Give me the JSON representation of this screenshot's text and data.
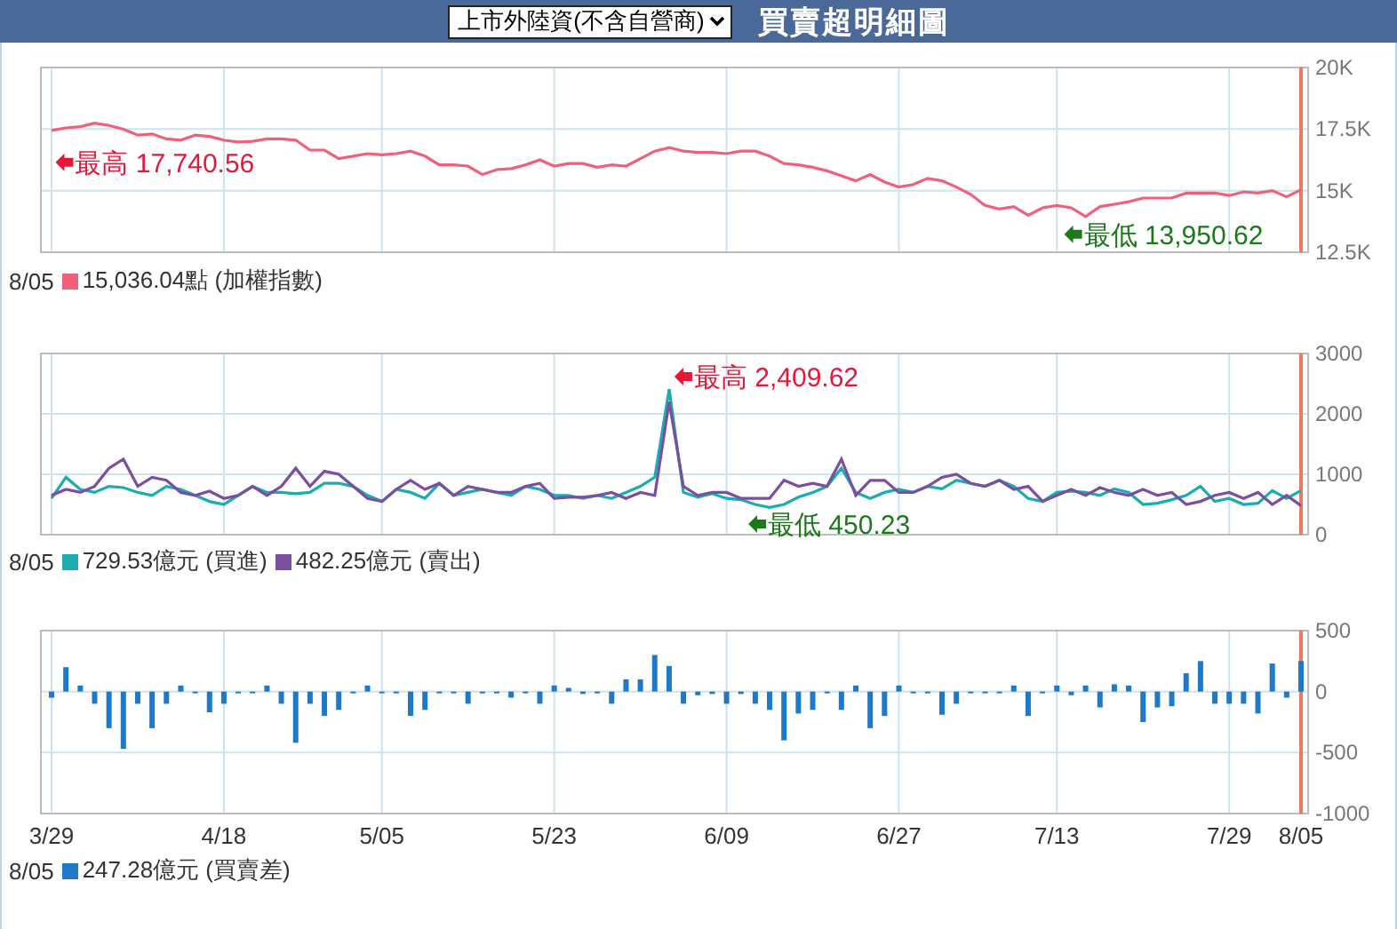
{
  "header": {
    "select": {
      "value": "上市外陸資(不含自營商)"
    },
    "title": "買賣超明細圖"
  },
  "charts": [
    {
      "legend": {
        "date": "8/05",
        "items": [
          {
            "color": "#f0607a",
            "text": "15,036.04點 (加權指數)"
          }
        ]
      },
      "extremes": [
        {
          "kind": "high",
          "text": "最高 17,740.56",
          "color": "#e8173a"
        },
        {
          "kind": "low",
          "text": "最低 13,950.62",
          "color": "#1a7a1a"
        }
      ],
      "chart_data": {
        "type": "line",
        "grid": true,
        "categories": [
          null,
          null,
          null,
          null,
          null,
          null,
          null,
          null,
          null,
          null,
          null,
          null,
          null,
          null,
          null,
          null,
          null,
          null,
          null,
          null,
          null,
          null,
          null,
          null,
          null,
          null,
          null,
          null,
          null,
          null,
          null,
          null,
          null,
          null,
          null,
          null,
          null,
          null,
          null,
          null,
          null,
          null,
          null,
          null,
          null,
          null,
          null,
          null,
          null,
          null,
          null,
          null,
          null,
          null,
          null,
          null,
          null,
          null,
          null,
          null,
          null,
          null,
          null,
          null,
          null,
          null,
          null,
          null,
          null,
          null,
          null,
          null,
          null,
          null,
          null,
          null,
          null,
          null,
          null,
          null,
          null,
          null,
          null,
          null,
          null,
          null,
          null,
          null
        ],
        "ylim": [
          12500,
          20000
        ],
        "yticks": [
          {
            "value": 12500,
            "label": "12.5K"
          },
          {
            "value": 15000,
            "label": "15K"
          },
          {
            "value": 17500,
            "label": "17.5K"
          },
          {
            "value": 20000,
            "label": "20K"
          }
        ],
        "series": [
          {
            "color": "#f0607a",
            "values": [
              17450,
              17550,
              17600,
              17740,
              17650,
              17500,
              17250,
              17300,
              17100,
              17050,
              17250,
              17200,
              17050,
              16980,
              17000,
              17100,
              17100,
              17050,
              16650,
              16650,
              16300,
              16400,
              16500,
              16450,
              16500,
              16600,
              16400,
              16050,
              16050,
              16000,
              15650,
              15850,
              15900,
              16050,
              16250,
              16000,
              16100,
              16100,
              15950,
              16050,
              16000,
              16300,
              16600,
              16750,
              16600,
              16550,
              16550,
              16500,
              16600,
              16600,
              16400,
              16100,
              16050,
              15950,
              15800,
              15600,
              15400,
              15650,
              15350,
              15150,
              15250,
              15500,
              15400,
              15150,
              14850,
              14400,
              14250,
              14350,
              14000,
              14300,
              14400,
              14300,
              13950,
              14350,
              14450,
              14550,
              14700,
              14700,
              14700,
              14900,
              14900,
              14900,
              14800,
              14950,
              14900,
              15000,
              14750,
              15040
            ]
          }
        ]
      }
    },
    {
      "legend": {
        "date": "8/05",
        "items": [
          {
            "color": "#1aacb0",
            "text": "729.53億元 (買進)"
          },
          {
            "color": "#7b4fa0",
            "text": "482.25億元 (賣出)"
          }
        ]
      },
      "extremes": [
        {
          "kind": "high",
          "text": "最高 2,409.62",
          "color": "#e8173a"
        },
        {
          "kind": "low",
          "text": "最低 450.23",
          "color": "#1a7a1a"
        }
      ],
      "chart_data": {
        "type": "line",
        "grid": true,
        "categories": [
          null,
          null,
          null,
          null,
          null,
          null,
          null,
          null,
          null,
          null,
          null,
          null,
          null,
          null,
          null,
          null,
          null,
          null,
          null,
          null,
          null,
          null,
          null,
          null,
          null,
          null,
          null,
          null,
          null,
          null,
          null,
          null,
          null,
          null,
          null,
          null,
          null,
          null,
          null,
          null,
          null,
          null,
          null,
          null,
          null,
          null,
          null,
          null,
          null,
          null,
          null,
          null,
          null,
          null,
          null,
          null,
          null,
          null,
          null,
          null,
          null,
          null,
          null,
          null,
          null,
          null,
          null,
          null,
          null,
          null,
          null,
          null,
          null,
          null,
          null,
          null,
          null,
          null,
          null,
          null,
          null,
          null,
          null,
          null,
          null,
          null,
          null,
          null
        ],
        "ylim": [
          0,
          3000
        ],
        "yticks": [
          {
            "value": 0,
            "label": "0"
          },
          {
            "value": 1000,
            "label": "1000"
          },
          {
            "value": 2000,
            "label": "2000"
          },
          {
            "value": 3000,
            "label": "3000"
          }
        ],
        "series": [
          {
            "color": "#1aacb0",
            "values": [
              600,
              950,
              750,
              700,
              800,
              780,
              700,
              650,
              800,
              750,
              650,
              550,
              500,
              650,
              800,
              700,
              700,
              680,
              700,
              850,
              850,
              800,
              650,
              550,
              750,
              700,
              600,
              850,
              650,
              700,
              750,
              700,
              650,
              800,
              750,
              650,
              650,
              600,
              650,
              600,
              700,
              800,
              950,
              2410,
              700,
              620,
              680,
              600,
              580,
              500,
              450,
              500,
              620,
              700,
              800,
              1100,
              700,
              600,
              700,
              750,
              700,
              800,
              760,
              900,
              850,
              800,
              900,
              800,
              600,
              550,
              700,
              720,
              700,
              650,
              760,
              700,
              500,
              520,
              580,
              650,
              800,
              550,
              600,
              500,
              520,
              730,
              600,
              730
            ]
          },
          {
            "color": "#7b4fa0",
            "values": [
              650,
              750,
              700,
              800,
              1100,
              1250,
              800,
              950,
              900,
              700,
              650,
              720,
              600,
              650,
              800,
              650,
              800,
              1100,
              800,
              1050,
              1000,
              800,
              600,
              550,
              750,
              900,
              750,
              850,
              650,
              800,
              750,
              700,
              700,
              800,
              850,
              600,
              620,
              620,
              650,
              700,
              600,
              700,
              650,
              2200,
              800,
              650,
              700,
              700,
              600,
              600,
              600,
              900,
              800,
              850,
              800,
              1250,
              650,
              900,
              900,
              700,
              700,
              800,
              950,
              1000,
              850,
              800,
              900,
              750,
              800,
              550,
              650,
              750,
              650,
              780,
              700,
              650,
              750,
              650,
              700,
              500,
              550,
              650,
              700,
              600,
              700,
              500,
              650,
              480
            ]
          }
        ]
      }
    },
    {
      "legend": {
        "date": "8/05",
        "items": [
          {
            "color": "#1f78c8",
            "text": "247.28億元 (買賣差)"
          }
        ]
      },
      "chart_data": {
        "type": "bar",
        "grid": true,
        "categories": [
          "3/29",
          null,
          null,
          null,
          null,
          null,
          null,
          null,
          null,
          null,
          null,
          null,
          "4/18",
          null,
          null,
          null,
          null,
          null,
          null,
          null,
          null,
          null,
          null,
          "5/05",
          null,
          null,
          null,
          null,
          null,
          null,
          null,
          null,
          null,
          null,
          null,
          "5/23",
          null,
          null,
          null,
          null,
          null,
          null,
          null,
          null,
          null,
          null,
          null,
          "6/09",
          null,
          null,
          null,
          null,
          null,
          null,
          null,
          null,
          null,
          null,
          null,
          "6/27",
          null,
          null,
          null,
          null,
          null,
          null,
          null,
          null,
          null,
          null,
          "7/13",
          null,
          null,
          null,
          null,
          null,
          null,
          null,
          null,
          null,
          null,
          null,
          "7/29",
          null,
          null,
          null,
          null,
          "8/05"
        ],
        "ylim": [
          -1000,
          500
        ],
        "yticks": [
          500,
          0,
          -500,
          -1000
        ],
        "series": [
          {
            "color": "#1f78c8",
            "values": [
              -50,
              200,
              50,
              -100,
              -300,
              -470,
              -100,
              -300,
              -100,
              50,
              0,
              -170,
              -100,
              0,
              0,
              50,
              -100,
              -420,
              -100,
              -200,
              -150,
              0,
              50,
              0,
              0,
              -200,
              -150,
              0,
              0,
              -100,
              0,
              0,
              -50,
              0,
              -100,
              50,
              30,
              -20,
              0,
              -100,
              100,
              100,
              300,
              210,
              -100,
              -30,
              -20,
              -100,
              -20,
              -100,
              -150,
              -400,
              -180,
              -150,
              0,
              -150,
              50,
              -300,
              -200,
              50,
              0,
              0,
              -190,
              -100,
              0,
              0,
              0,
              50,
              -200,
              0,
              50,
              -30,
              50,
              -130,
              60,
              50,
              -250,
              -130,
              -120,
              150,
              250,
              -100,
              -100,
              -100,
              -180,
              230,
              -50,
              250
            ]
          }
        ]
      }
    }
  ]
}
